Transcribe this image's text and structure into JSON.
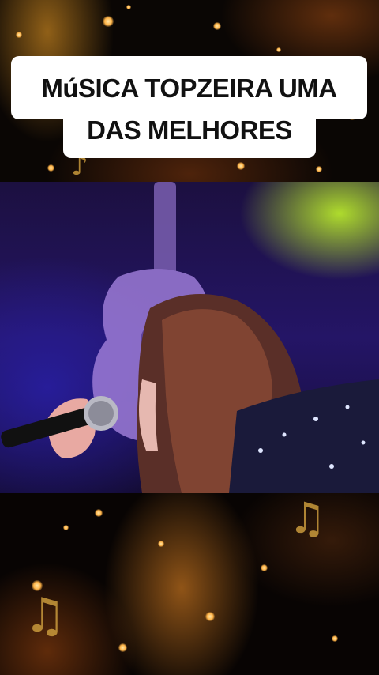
{
  "caption": {
    "line1": "MúSICA TOPZEIRA UMA",
    "line2": "DAS MELHORES"
  },
  "scene": {
    "description_icons": [
      "guitar-silhouette",
      "microphone",
      "music-note"
    ]
  },
  "colors": {
    "caption_bg": "#ffffff",
    "caption_text": "#111111",
    "stage_purple": "#241566",
    "spotlight_green": "#c8ff28",
    "sparkle_gold": "#ffb347"
  }
}
